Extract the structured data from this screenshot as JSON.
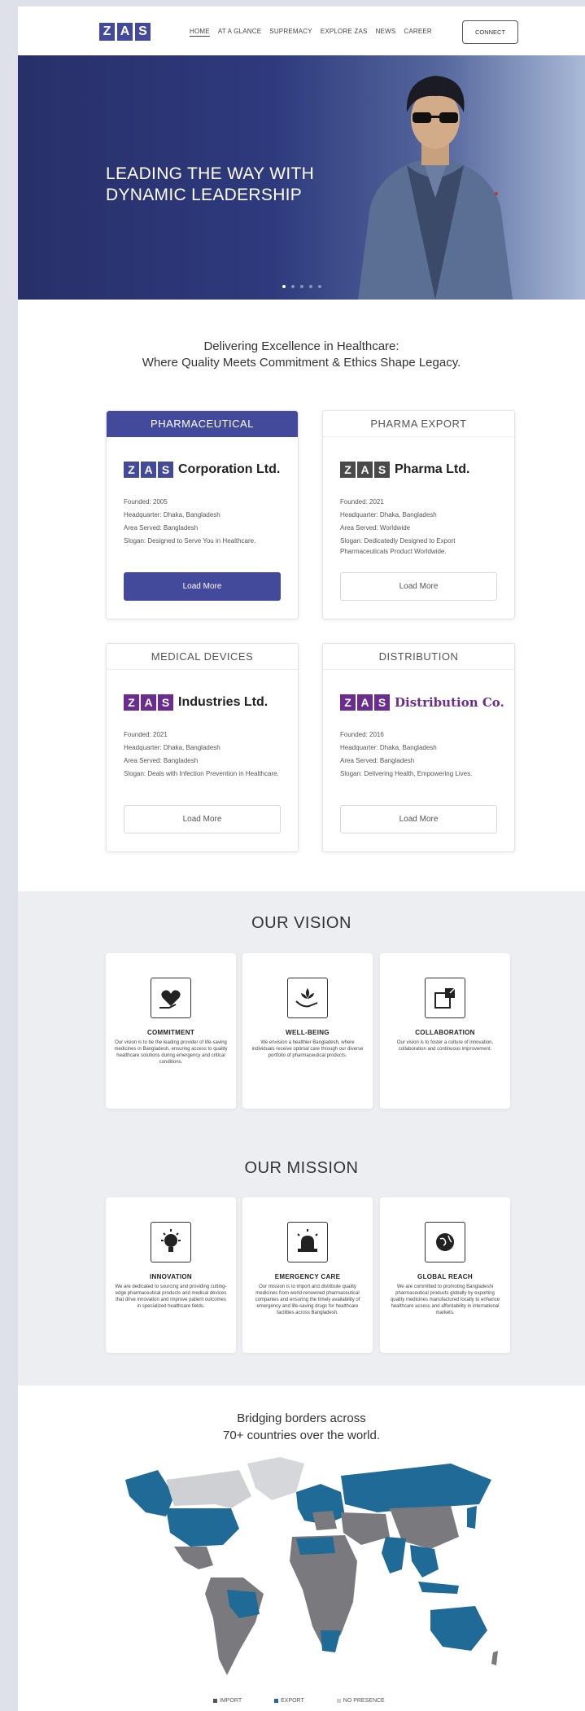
{
  "nav": {
    "logo": [
      "Z",
      "A",
      "S"
    ],
    "items": [
      "HOME",
      "AT A GLANCE",
      "SUPREMACY",
      "EXPLORE ZAS",
      "NEWS",
      "CAREER"
    ],
    "connect": "CONNECT"
  },
  "hero": {
    "title_line1": "LEADING THE WAY WITH",
    "title_line2": "DYNAMIC LEADERSHIP",
    "slides": 5,
    "active_slide": 1
  },
  "intro": {
    "line1": "Delivering Excellence in Healthcare:",
    "line2": "Where Quality Meets Commitment & Ethics Shape Legacy."
  },
  "cards": [
    {
      "category": "PHARMACEUTICAL",
      "brand": "Corporation Ltd.",
      "brand_color": "#434a9c",
      "founded": "Founded: 2005",
      "hq": "Headquarter: Dhaka, Bangladesh",
      "area": "Area Served: Bangladesh",
      "slogan": "Slogan: Designed to Serve You in Healthcare.",
      "button": "Load More"
    },
    {
      "category": "PHARMA EXPORT",
      "brand": "Pharma Ltd.",
      "brand_color": "#444444",
      "founded": "Founded: 2021",
      "hq": "Headquarter: Dhaka, Bangladesh",
      "area": "Area Served: Worldwide",
      "slogan": "Slogan: Dedicatedly Designed to Export Pharmaceuticals Product Worldwide.",
      "button": "Load More"
    },
    {
      "category": "MEDICAL DEVICES",
      "brand": "Industries Ltd.",
      "brand_color": "#6a2d8f",
      "founded": "Founded: 2021",
      "hq": "Headquarter: Dhaka, Bangladesh",
      "area": "Area Served: Bangladesh",
      "slogan": "Slogan: Deals with Infection Prevention in Healthcare.",
      "button": "Load More"
    },
    {
      "category": "DISTRIBUTION",
      "brand": "Distribution Co.",
      "brand_color": "#6a2d8f",
      "founded": "Founded: 2016",
      "hq": "Headquarter: Dhaka, Bangladesh",
      "area": "Area Served: Bangladesh",
      "slogan": "Slogan: Delivering Health, Empowering Lives.",
      "button": "Load More"
    }
  ],
  "vision": {
    "title": "OUR VISION",
    "items": [
      {
        "icon": "heart-hand-icon",
        "heading": "COMMITMENT",
        "text": "Our vision is to be the leading provider of life-saving medicines in Bangladesh, ensuring access to quality healthcare solutions during emergency and critical conditions."
      },
      {
        "icon": "lotus-hand-icon",
        "heading": "WELL-BEING",
        "text": "We envision a healthier Bangladesh, where individuals receive optimal care through our diverse portfolio of pharmaceutical products."
      },
      {
        "icon": "puzzle-icon",
        "heading": "COLLABORATION",
        "text": "Our vision is to foster a culture of innovation, collaboration and continuous improvement."
      }
    ]
  },
  "mission": {
    "title": "OUR MISSION",
    "items": [
      {
        "icon": "lightbulb-icon",
        "heading": "INNOVATION",
        "text": "We are dedicated to sourcing and providing cutting-edge pharmaceutical products and medical devices that drive innovation and improve patient outcomes in specialized healthcare fields."
      },
      {
        "icon": "siren-icon",
        "heading": "EMERGENCY CARE",
        "text": "Our mission is to import and distribute quality medicines from world-renowned pharmaceutical companies and ensuring the timely availability of emergency and life-saving drugs for healthcare facilities across Bangladesh."
      },
      {
        "icon": "globe-icon",
        "heading": "GLOBAL REACH",
        "text": "We are committed to promoting Bangladeshi pharmaceutical products globally by exporting quality medicines manufactured locally to enhance healthcare access and affordability in international markets."
      }
    ]
  },
  "map": {
    "title_line1": "Bridging borders across",
    "title_line2": "70+ countries over the world.",
    "legend": [
      {
        "label": "IMPORT",
        "color": "#555555"
      },
      {
        "label": "EXPORT",
        "color": "#1f6a96"
      },
      {
        "label": "NO PRESENCE",
        "color": "#cfd0d4"
      }
    ]
  }
}
